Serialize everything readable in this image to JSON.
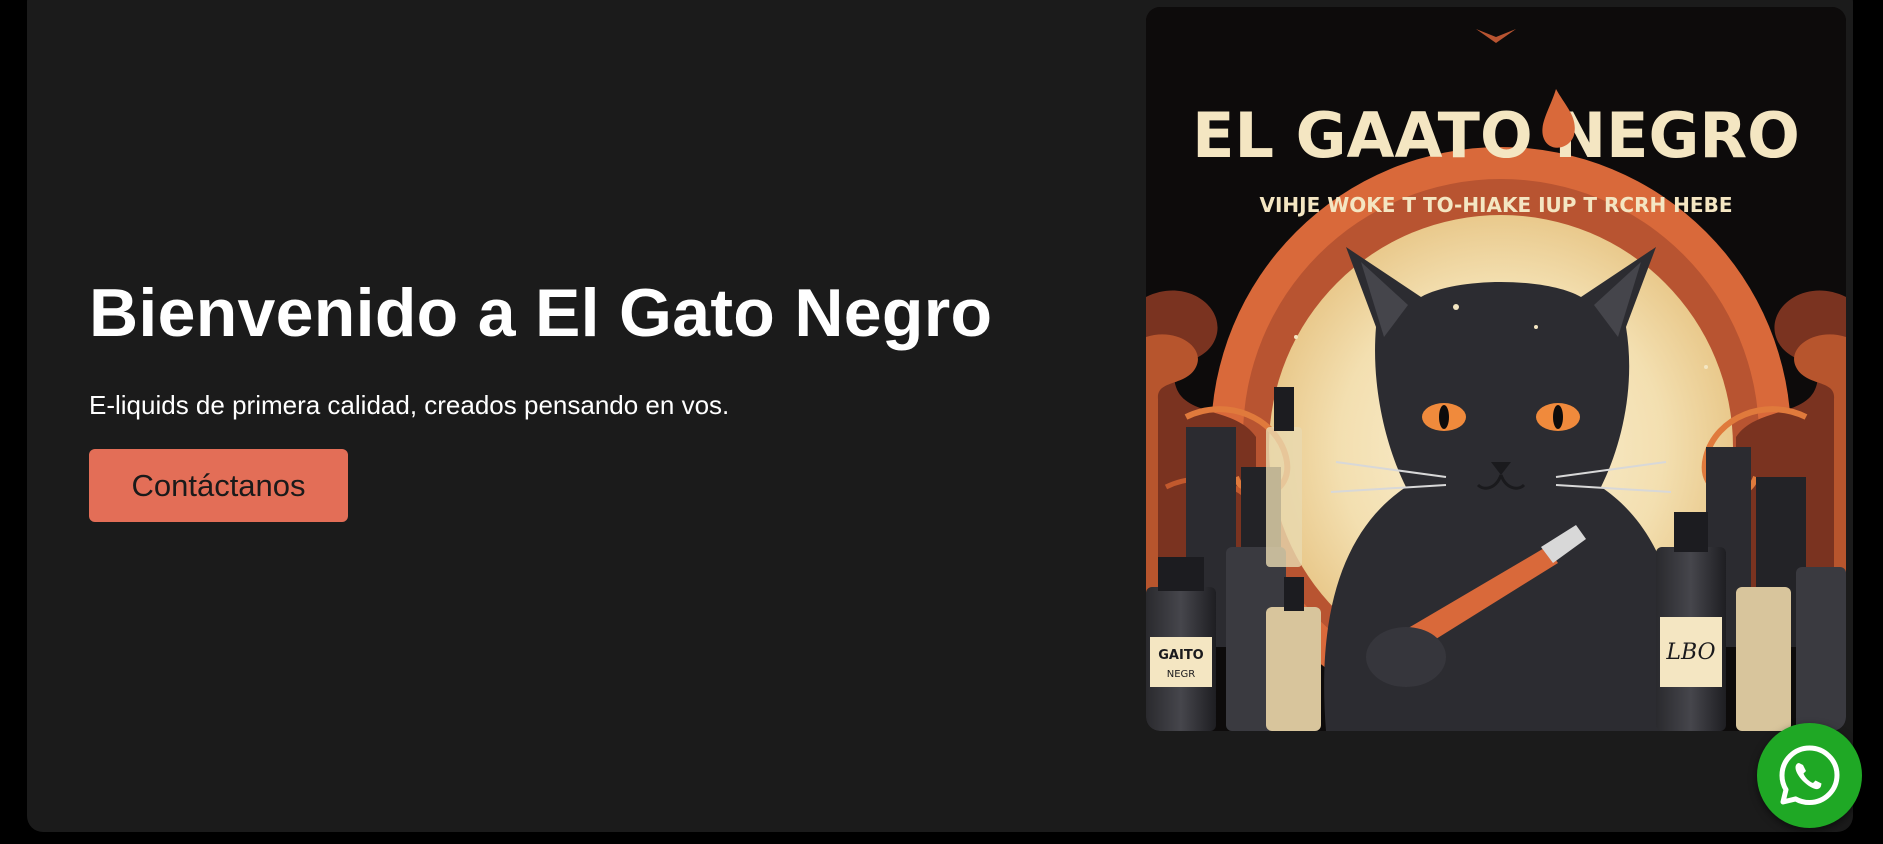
{
  "hero": {
    "title": "Bienvenido a El Gato Negro",
    "subtitle": "E-liquids de primera calidad, creados pensando en vos.",
    "cta_label": "Contáctanos",
    "cta_color": "#e36e57"
  },
  "hero_image": {
    "icon": "black-cat-vape-illustration",
    "headline_text": "EL GAATO NEGRO",
    "tagline_text": "VIHJE WOKE T TO-HIAKE IUP T RCRH HEBE",
    "bottle_label_left": "GAITO",
    "bottle_label_left_sub": "NEGR",
    "bottle_label_right": "LBO"
  },
  "whatsapp": {
    "icon": "whatsapp-icon",
    "color": "#1fa825"
  },
  "colors": {
    "page_background": "#000000",
    "panel_background": "#1b1b1b",
    "text": "#ffffff",
    "art_cream": "#f4e6c2",
    "art_orange": "#d9693a"
  }
}
